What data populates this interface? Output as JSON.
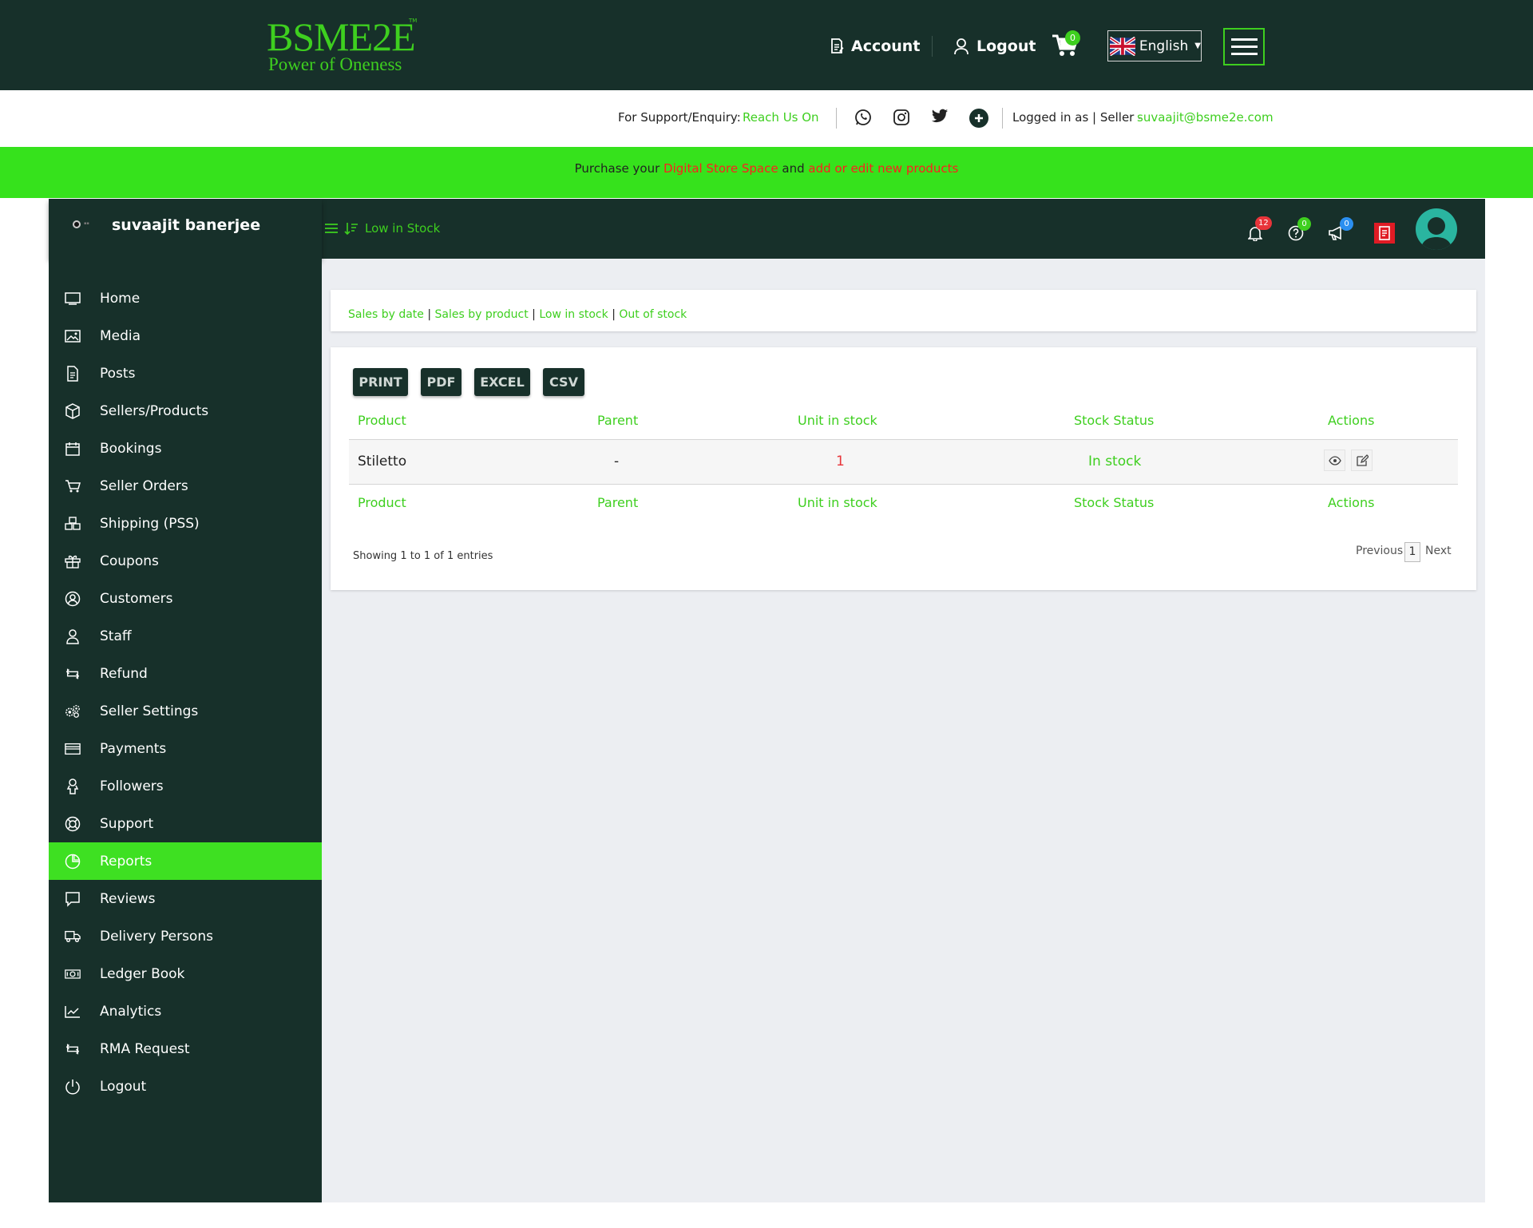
{
  "header": {
    "logo_title": "BSME2E",
    "logo_tm": "TM",
    "logo_tagline": "Power of Oneness",
    "account_label": "Account",
    "logout_label": "Logout",
    "cart_count": "0",
    "language": "English"
  },
  "support": {
    "prefix": "For Support/Enquiry:",
    "reach_label": "Reach Us On",
    "logged_in_prefix": "Logged in as | Seller -",
    "email": "suvaajit@bsme2e.com"
  },
  "promo": {
    "p1": "Purchase your",
    "link1": "Digital Store Space",
    "p2": "and",
    "link2": "add or edit new products"
  },
  "dashboard": {
    "user_name": "suvaajit banerjee",
    "breadcrumb": "Low in Stock",
    "notifications_count": "12",
    "questions_count": "0",
    "announcements_count": "0"
  },
  "sidebar": {
    "items": [
      {
        "label": "Home",
        "icon": "monitor-icon"
      },
      {
        "label": "Media",
        "icon": "image-icon"
      },
      {
        "label": "Posts",
        "icon": "document-icon"
      },
      {
        "label": "Sellers/Products",
        "icon": "cube-icon"
      },
      {
        "label": "Bookings",
        "icon": "calendar-icon"
      },
      {
        "label": "Seller Orders",
        "icon": "cart-icon"
      },
      {
        "label": "Shipping (PSS)",
        "icon": "boxes-icon"
      },
      {
        "label": "Coupons",
        "icon": "gift-icon"
      },
      {
        "label": "Customers",
        "icon": "user-circle-icon"
      },
      {
        "label": "Staff",
        "icon": "user-icon"
      },
      {
        "label": "Refund",
        "icon": "repeat-icon"
      },
      {
        "label": "Seller Settings",
        "icon": "gears-icon"
      },
      {
        "label": "Payments",
        "icon": "credit-card-icon"
      },
      {
        "label": "Followers",
        "icon": "followers-icon"
      },
      {
        "label": "Support",
        "icon": "lifebuoy-icon"
      },
      {
        "label": "Reports",
        "icon": "pie-chart-icon",
        "active": true
      },
      {
        "label": "Reviews",
        "icon": "comment-icon"
      },
      {
        "label": "Delivery Persons",
        "icon": "truck-icon"
      },
      {
        "label": "Ledger Book",
        "icon": "money-icon"
      },
      {
        "label": "Analytics",
        "icon": "line-chart-icon"
      },
      {
        "label": "RMA Request",
        "icon": "repeat-icon"
      },
      {
        "label": "Logout",
        "icon": "power-icon"
      }
    ]
  },
  "report_links": {
    "sales_by_date": "Sales by date",
    "sales_by_product": "Sales by product",
    "low_in_stock": "Low in stock",
    "out_of_stock": "Out of stock",
    "separator": "|"
  },
  "export_buttons": {
    "print": "PRINT",
    "pdf": "PDF",
    "excel": "EXCEL",
    "csv": "CSV"
  },
  "table": {
    "columns": [
      "Product",
      "Parent",
      "Unit in stock",
      "Stock Status",
      "Actions"
    ],
    "rows": [
      {
        "product": "Stiletto",
        "parent": "-",
        "unit_in_stock": "1",
        "stock_status": "In stock"
      }
    ],
    "showing": "Showing 1 to 1 of 1 entries",
    "pagination": {
      "previous": "Previous",
      "current": "1",
      "next": "Next"
    }
  },
  "colors": {
    "header_bg": "#17302a",
    "accent_green": "#3ecf1f",
    "promo_bg": "#36e21c",
    "link_red": "#ff1e1e",
    "badge_red": "#e8343a",
    "badge_blue": "#2b8ff0"
  }
}
